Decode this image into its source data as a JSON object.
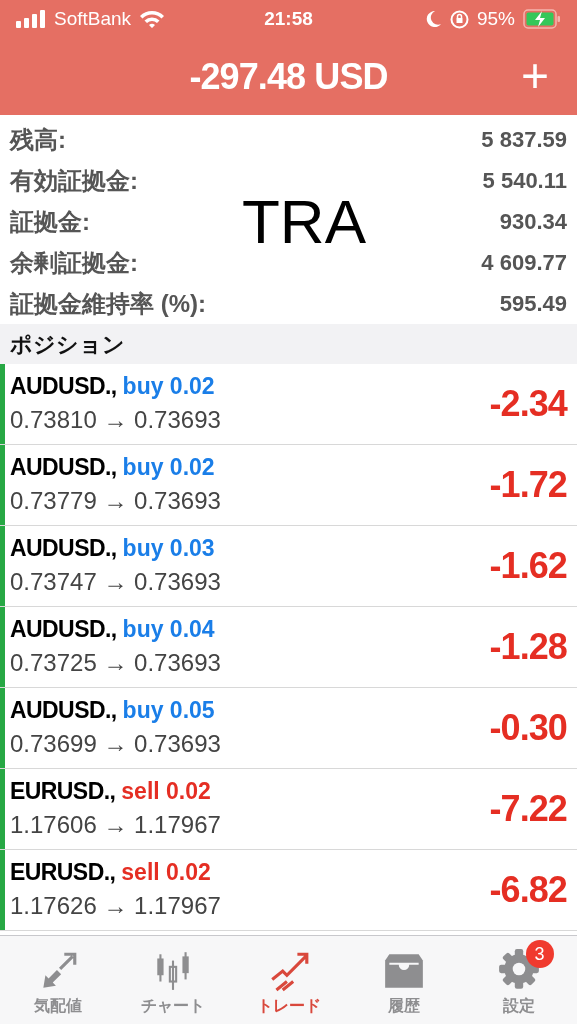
{
  "status_bar": {
    "carrier": "SoftBank",
    "time": "21:58",
    "battery": "95%"
  },
  "header": {
    "title": "-297.48 USD",
    "add": "+"
  },
  "summary": [
    {
      "label": "残高:",
      "value": "5 837.59"
    },
    {
      "label": "有効証拠金:",
      "value": "5 540.11"
    },
    {
      "label": "証拠金:",
      "value": "930.34"
    },
    {
      "label": "余剰証拠金:",
      "value": "4 609.77"
    },
    {
      "label": "証拠金維持率 (%):",
      "value": "595.49"
    }
  ],
  "overlay_text": "TRA",
  "section": "ポジション",
  "positions": [
    {
      "symbol": "AUDUSD.,",
      "order": "buy 0.02",
      "kind": "buy",
      "prices": "0.73810 → 0.73693",
      "profit": "-2.34"
    },
    {
      "symbol": "AUDUSD.,",
      "order": "buy 0.02",
      "kind": "buy",
      "prices": "0.73779 → 0.73693",
      "profit": "-1.72"
    },
    {
      "symbol": "AUDUSD.,",
      "order": "buy 0.03",
      "kind": "buy",
      "prices": "0.73747 → 0.73693",
      "profit": "-1.62"
    },
    {
      "symbol": "AUDUSD.,",
      "order": "buy 0.04",
      "kind": "buy",
      "prices": "0.73725 → 0.73693",
      "profit": "-1.28"
    },
    {
      "symbol": "AUDUSD.,",
      "order": "buy 0.05",
      "kind": "buy",
      "prices": "0.73699 → 0.73693",
      "profit": "-0.30"
    },
    {
      "symbol": "EURUSD.,",
      "order": "sell 0.02",
      "kind": "sell",
      "prices": "1.17606 → 1.17967",
      "profit": "-7.22"
    },
    {
      "symbol": "EURUSD.,",
      "order": "sell 0.02",
      "kind": "sell",
      "prices": "1.17626 → 1.17967",
      "profit": "-6.82"
    }
  ],
  "tabs": [
    {
      "label": "気配値",
      "selected": false
    },
    {
      "label": "チャート",
      "selected": false
    },
    {
      "label": "トレード",
      "selected": true
    },
    {
      "label": "履歴",
      "selected": false
    },
    {
      "label": "設定",
      "selected": false,
      "badge": "3"
    }
  ]
}
